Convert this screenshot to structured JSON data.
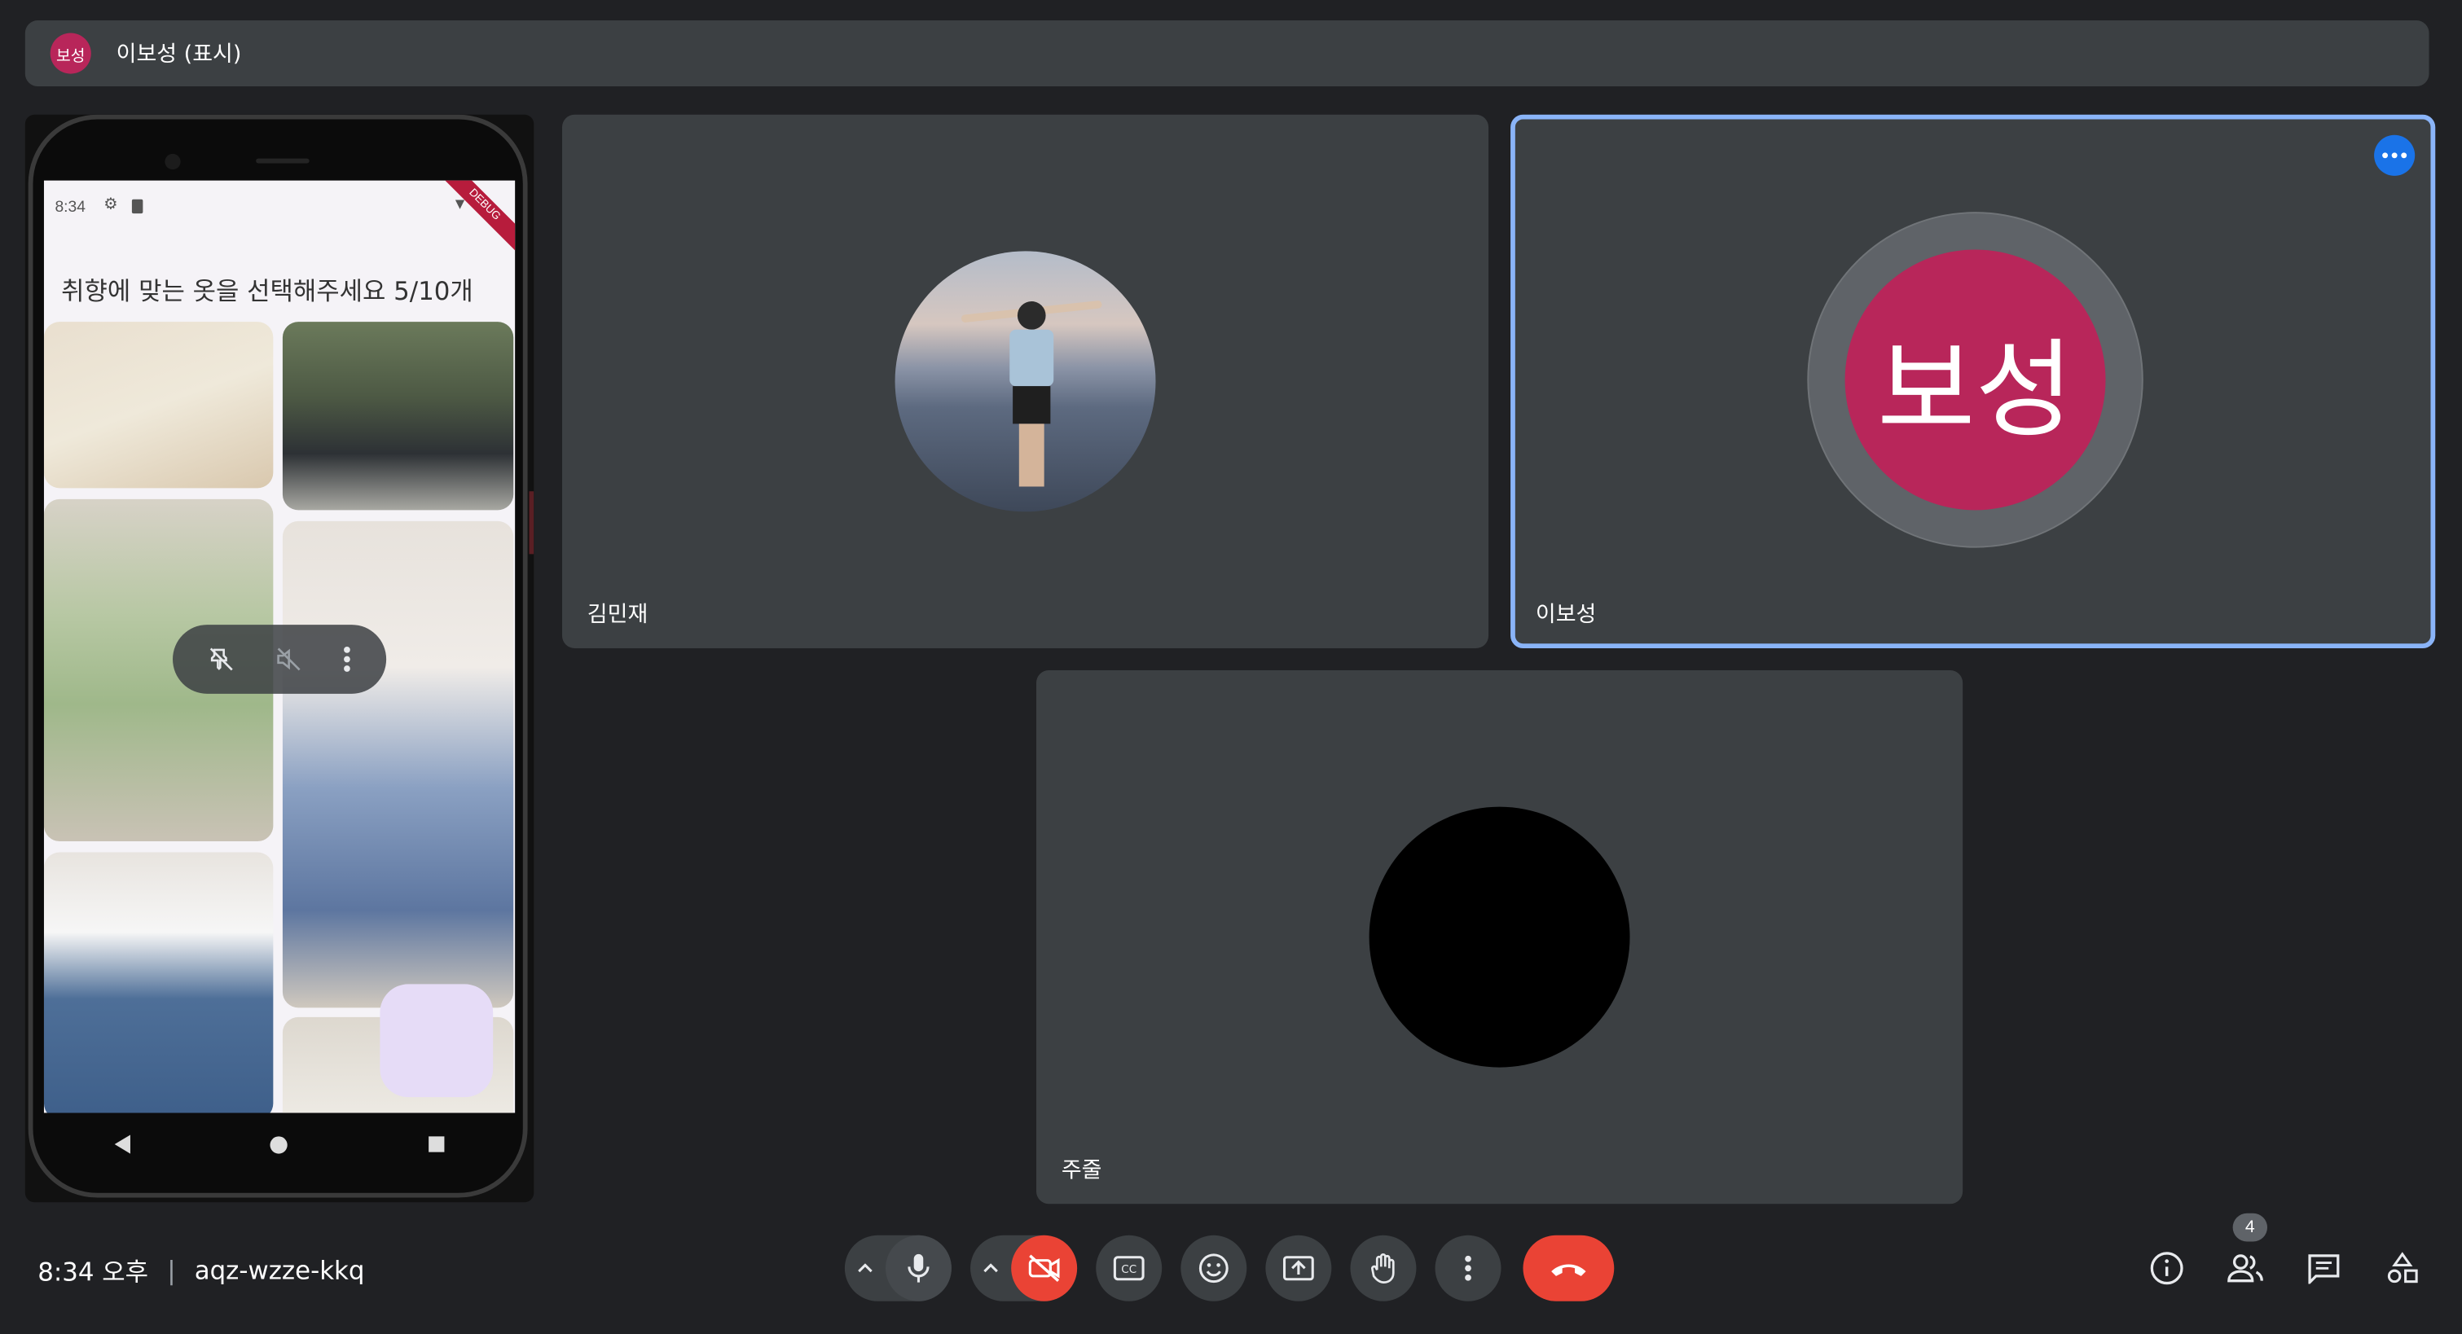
{
  "presenter": {
    "avatar_text": "보성",
    "name_label": "이보성 (표시)"
  },
  "phone_screen": {
    "status_time": "8:34",
    "debug_banner": "DEBUG",
    "title": "취향에 맞는 옷을 선택해주세요 5/10개"
  },
  "participants": [
    {
      "name": "김민재",
      "avatar": "photo"
    },
    {
      "name": "이보성",
      "avatar_text": "보성",
      "avatar_color": "#b8265a"
    },
    {
      "name": "주줄",
      "avatar": "black-circle"
    }
  ],
  "meeting": {
    "time": "8:34 오후",
    "separator": "|",
    "code": "aqz-wzze-kkq"
  },
  "controls": {
    "icons": [
      "mic-icon",
      "video-off-icon",
      "captions-icon",
      "emoji-icon",
      "present-icon",
      "raise-hand-icon",
      "more-options-icon",
      "end-call-icon"
    ],
    "video_off_color": "#ea4335",
    "end_call_color": "#ea4335"
  },
  "right_panel": {
    "icons": [
      "info-icon",
      "people-icon",
      "chat-icon",
      "activities-icon"
    ],
    "people_count": "4"
  },
  "colors": {
    "background": "#202124",
    "tile": "#3c4043",
    "active_speaker_border": "#8ab4f8",
    "accent_blue": "#1a73e8"
  }
}
